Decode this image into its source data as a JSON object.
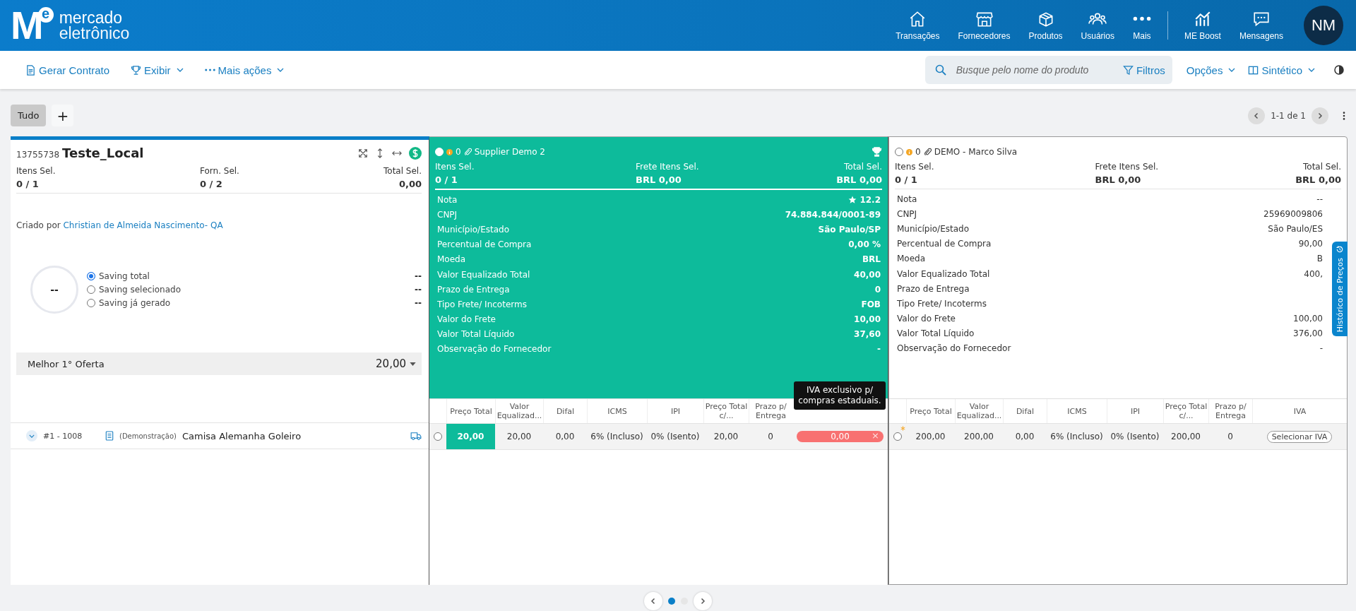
{
  "header": {
    "logo_mark": "M",
    "logo_sup": "e",
    "logo_line1": "mercado",
    "logo_line2": "eletrônico",
    "nav": [
      {
        "label": "Transações",
        "kind": "home"
      },
      {
        "label": "Fornecedores",
        "kind": "store"
      },
      {
        "label": "Produtos",
        "kind": "box"
      },
      {
        "label": "Usuários",
        "kind": "users"
      },
      {
        "label": "Mais",
        "kind": "dots"
      },
      {
        "label": "ME Boost",
        "kind": "chart"
      },
      {
        "label": "Mensagens",
        "kind": "chat"
      }
    ],
    "avatar": "NM"
  },
  "toolbar": {
    "actions": [
      {
        "label": "Gerar Contrato",
        "kind": "doc",
        "dropdown": false
      },
      {
        "label": "Exibir",
        "kind": "trophy",
        "dropdown": true
      },
      {
        "label": "Mais ações",
        "kind": "dots",
        "dropdown": true
      }
    ],
    "search": {
      "placeholder": "Busque pelo nome do produto"
    },
    "filters": "Filtros",
    "menus": [
      {
        "label": "Opções",
        "kind": "none"
      },
      {
        "label": "Sintético",
        "kind": "columns"
      }
    ]
  },
  "tabs": [
    {
      "label": "Tudo",
      "selected": true
    }
  ],
  "add_tab": "+",
  "pagination": {
    "text": "1-1 de 1"
  },
  "request": {
    "id": "13755738",
    "title": "Teste_Local",
    "stats": [
      {
        "label": "Itens Sel.",
        "value": "0 / 1"
      },
      {
        "label": "Forn. Sel.",
        "value": "0 / 2"
      },
      {
        "label": "Total Sel.",
        "value": "0,00"
      }
    ],
    "created_label": "Criado por",
    "creator": "Christian de Almeida Nascimento- QA",
    "saving_value": "--",
    "savings": [
      {
        "label": "Saving total",
        "value": "--",
        "selected": true
      },
      {
        "label": "Saving selecionado",
        "value": "--",
        "selected": false
      },
      {
        "label": "Saving já gerado",
        "value": "--",
        "selected": false
      }
    ],
    "best_offer": {
      "label": "Melhor 1° Oferta",
      "value": "20,00"
    },
    "item": {
      "number": "#1 - 1008",
      "tag": "(Demonstração)",
      "name": "Camisa Alemanha Goleiro",
      "expanded": false
    }
  },
  "suppliers": [
    {
      "name": "Supplier Demo 2",
      "selected": false,
      "highlighted": true,
      "trophy": true,
      "count": "0",
      "stats": [
        {
          "label": "Itens Sel.",
          "value": "0 / 1"
        },
        {
          "label": "Frete Itens Sel.",
          "value": "BRL 0,00"
        },
        {
          "label": "Total Sel.",
          "value": "BRL 0,00"
        }
      ],
      "details": [
        {
          "label": "Nota",
          "value": "12.2",
          "star": true
        },
        {
          "label": "CNPJ",
          "value": "74.884.844/0001-89",
          "star": false
        },
        {
          "label": "Município/Estado",
          "value": "São Paulo/SP",
          "star": false
        },
        {
          "label": "Percentual de Compra",
          "value": "0,00 %",
          "star": false
        },
        {
          "label": "Moeda",
          "value": "BRL",
          "star": false
        },
        {
          "label": "Valor Equalizado Total",
          "value": "40,00",
          "star": false
        },
        {
          "label": "Prazo de Entrega",
          "value": "0",
          "star": false
        },
        {
          "label": "Tipo Frete/ Incoterms",
          "value": "FOB",
          "star": false
        },
        {
          "label": "Valor do Frete",
          "value": "10,00",
          "star": false
        },
        {
          "label": "Valor Total Líquido",
          "value": "37,60",
          "star": false
        },
        {
          "label": "Observação do Fornecedor",
          "value": "-",
          "star": false
        }
      ],
      "columns": [
        "Preço Total",
        "Valor Equalizad...",
        "Difal",
        "ICMS",
        "IPI",
        "Preço Total c/...",
        "Prazo p/ Entrega"
      ],
      "row": {
        "selected": false,
        "flagged": false,
        "cells": [
          {
            "value": "20,00",
            "best": true
          },
          {
            "value": "20,00",
            "best": false
          },
          {
            "value": "0,00",
            "best": false
          },
          {
            "value": "6% (Incluso)",
            "best": false
          },
          {
            "value": "0% (Isento)",
            "best": false
          },
          {
            "value": "20,00",
            "best": false
          },
          {
            "value": "0",
            "best": false
          }
        ],
        "iva": {
          "kind": "pill",
          "value": "0,00",
          "remove": "×"
        }
      },
      "tooltip": "IVA exclusivo p/ compras estaduais."
    },
    {
      "name": "DEMO - Marco Silva",
      "selected": false,
      "highlighted": false,
      "trophy": false,
      "count": "0",
      "stats": [
        {
          "label": "Itens Sel.",
          "value": "0 / 1"
        },
        {
          "label": "Frete Itens Sel.",
          "value": "BRL 0,00"
        },
        {
          "label": "Total Sel.",
          "value": "BRL 0,00"
        }
      ],
      "details": [
        {
          "label": "Nota",
          "value": "--",
          "star": false
        },
        {
          "label": "CNPJ",
          "value": "25969009806",
          "star": false
        },
        {
          "label": "Município/Estado",
          "value": "São Paulo/ES",
          "star": false
        },
        {
          "label": "Percentual de Compra",
          "value": "90,00",
          "star": false
        },
        {
          "label": "Moeda",
          "value": "B",
          "star": false
        },
        {
          "label": "Valor Equalizado Total",
          "value": "400,",
          "star": false
        },
        {
          "label": "Prazo de Entrega",
          "star": false
        },
        {
          "label": "Tipo Frete/ Incoterms",
          "star": false
        },
        {
          "label": "Valor do Frete",
          "value": "100,00",
          "star": false
        },
        {
          "label": "Valor Total Líquido",
          "value": "376,00",
          "star": false
        },
        {
          "label": "Observação do Fornecedor",
          "value": "-",
          "star": false
        }
      ],
      "columns": [
        "Preço Total",
        "Valor Equalizad...",
        "Difal",
        "ICMS",
        "IPI",
        "Preço Total c/...",
        "Prazo p/ Entrega",
        "IVA"
      ],
      "row": {
        "selected": false,
        "flagged": true,
        "cells": [
          {
            "value": "200,00",
            "best": false
          },
          {
            "value": "200,00",
            "best": false
          },
          {
            "value": "0,00",
            "best": false
          },
          {
            "value": "6% (Incluso)",
            "best": false
          },
          {
            "value": "0% (Isento)",
            "best": false
          },
          {
            "value": "200,00",
            "best": false
          },
          {
            "value": "0",
            "best": false
          }
        ],
        "iva": {
          "kind": "button",
          "label": "Selecionar IVA"
        }
      },
      "history_tab": "Histórico de Preços"
    }
  ],
  "carousel": [
    {
      "selected": true
    },
    {
      "selected": false
    }
  ]
}
